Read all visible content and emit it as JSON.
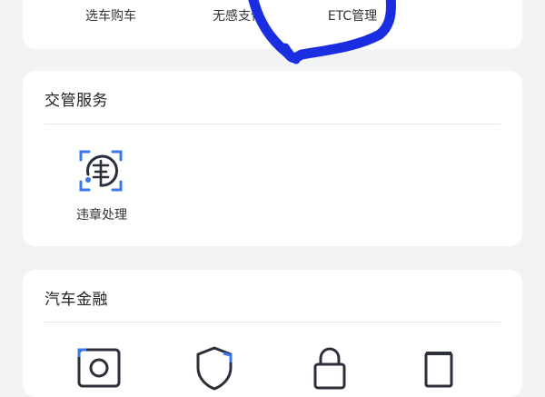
{
  "top_services": {
    "items": [
      {
        "label": "选车购车",
        "icon": "car-select-icon"
      },
      {
        "label": "无感支付",
        "icon": "contactless-pay-icon"
      },
      {
        "label": "ETC管理",
        "icon": "etc-icon"
      }
    ]
  },
  "traffic": {
    "title": "交管服务",
    "items": [
      {
        "label": "违章处理",
        "icon": "violation-icon"
      }
    ]
  },
  "finance": {
    "title": "汽车金融",
    "items": [
      {
        "icon": "camera-scan-icon"
      },
      {
        "icon": "shield-icon"
      },
      {
        "icon": "lock-icon"
      },
      {
        "icon": "document-icon"
      }
    ]
  },
  "colors": {
    "page_bg": "#f2f3f5",
    "card_bg": "#ffffff",
    "accent_blue": "#3a78f2",
    "icon_dark": "#2b2f3a",
    "pen_stroke": "#1b2de0"
  }
}
